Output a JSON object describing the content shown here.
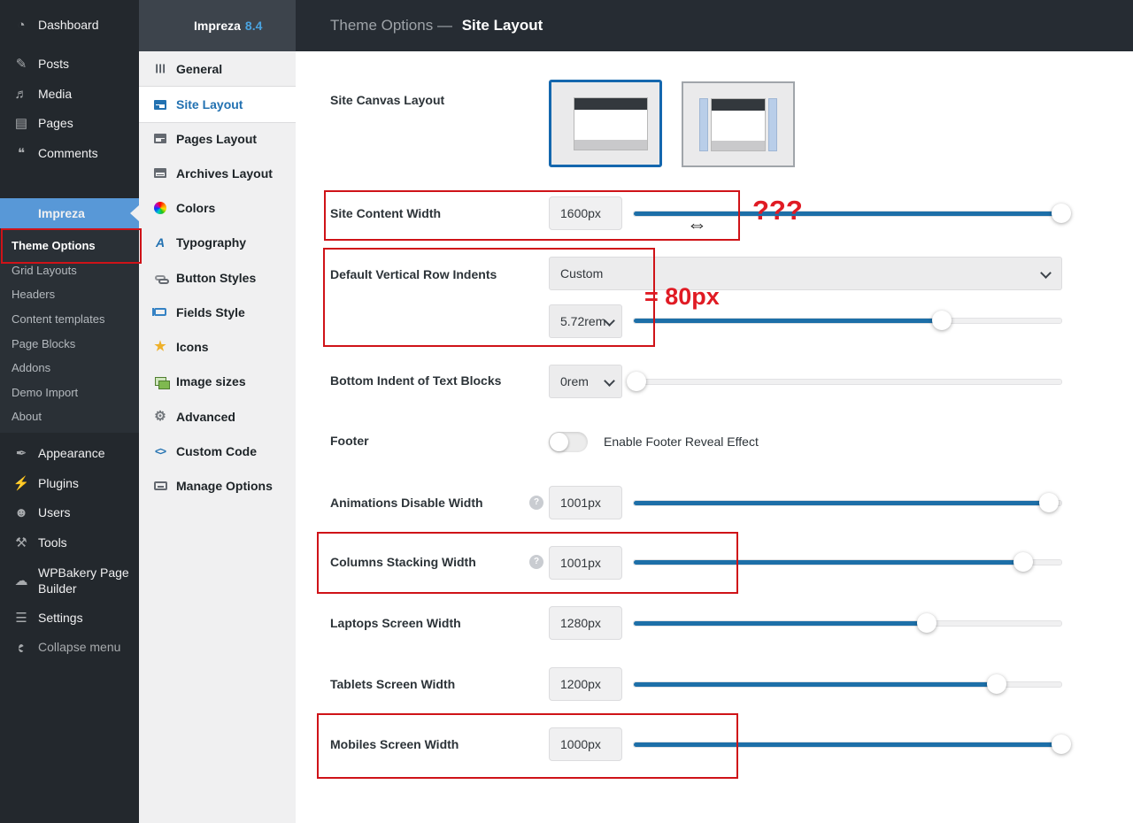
{
  "wp_sidebar": {
    "items": [
      {
        "label": "Dashboard",
        "glyph": "◔"
      },
      {
        "label": "Posts",
        "glyph": "✎"
      },
      {
        "label": "Media",
        "glyph": "♬"
      },
      {
        "label": "Pages",
        "glyph": "▤"
      },
      {
        "label": "Comments",
        "glyph": "❝"
      },
      {
        "label": "Impreza"
      },
      {
        "label": "Appearance",
        "glyph": "✒"
      },
      {
        "label": "Plugins",
        "glyph": "⚡"
      },
      {
        "label": "Users",
        "glyph": "☻"
      },
      {
        "label": "Tools",
        "glyph": "⚒"
      },
      {
        "label": "WPBakery Page Builder",
        "glyph": "☁"
      },
      {
        "label": "Settings",
        "glyph": "☰"
      },
      {
        "label": "Collapse menu",
        "glyph": "◀"
      }
    ],
    "impreza_submenu": [
      {
        "label": "Theme Options",
        "current": true
      },
      {
        "label": "Grid Layouts"
      },
      {
        "label": "Headers"
      },
      {
        "label": "Content templates"
      },
      {
        "label": "Page Blocks"
      },
      {
        "label": "Addons"
      },
      {
        "label": "Demo Import"
      },
      {
        "label": "About"
      }
    ]
  },
  "impreza_panel": {
    "name": "Impreza",
    "version": "8.4",
    "items": [
      {
        "label": "General",
        "glyph": "☰"
      },
      {
        "label": "Site Layout",
        "active": true
      },
      {
        "label": "Pages Layout"
      },
      {
        "label": "Archives Layout"
      },
      {
        "label": "Colors"
      },
      {
        "label": "Typography",
        "glyph": "A"
      },
      {
        "label": "Button Styles"
      },
      {
        "label": "Fields Style"
      },
      {
        "label": "Icons",
        "glyph": "★"
      },
      {
        "label": "Image sizes"
      },
      {
        "label": "Advanced",
        "glyph": "⚙"
      },
      {
        "label": "Custom Code",
        "glyph": "<>"
      },
      {
        "label": "Manage Options"
      }
    ]
  },
  "header": {
    "title_prefix": "Theme Options —",
    "title_current": "Site Layout"
  },
  "main": {
    "rows": [
      {
        "label": "Site Canvas Layout"
      },
      {
        "label": "Site Content Width",
        "value": "1600px",
        "slider_percent": 100
      },
      {
        "label": "Default Vertical Row Indents",
        "select_value": "Custom",
        "indent_value": "5.72rem",
        "slider_percent": 72
      },
      {
        "label": "Bottom Indent of Text Blocks",
        "value": "0rem",
        "slider_percent": 1
      },
      {
        "label": "Footer",
        "toggle_label": "Enable Footer Reveal Effect",
        "toggle_state": "off"
      },
      {
        "label": "Animations Disable Width",
        "value": "1001px",
        "slider_percent": 97,
        "help": true
      },
      {
        "label": "Columns Stacking Width",
        "value": "1001px",
        "slider_percent": 91,
        "help": true
      },
      {
        "label": "Laptops Screen Width",
        "value": "1280px",
        "slider_percent": 68
      },
      {
        "label": "Tablets Screen Width",
        "value": "1200px",
        "slider_percent": 85
      },
      {
        "label": "Mobiles Screen Width",
        "value": "1000px",
        "slider_percent": 100
      }
    ]
  },
  "annotations": {
    "color": "#e01b24",
    "question_marks": "???",
    "equals_label": "= 80px",
    "resize_cursor": "⇔",
    "boxes": [
      "theme-options",
      "site-content-width",
      "default-vertical-row-indents",
      "columns-stacking-width",
      "mobiles-screen-width"
    ]
  }
}
